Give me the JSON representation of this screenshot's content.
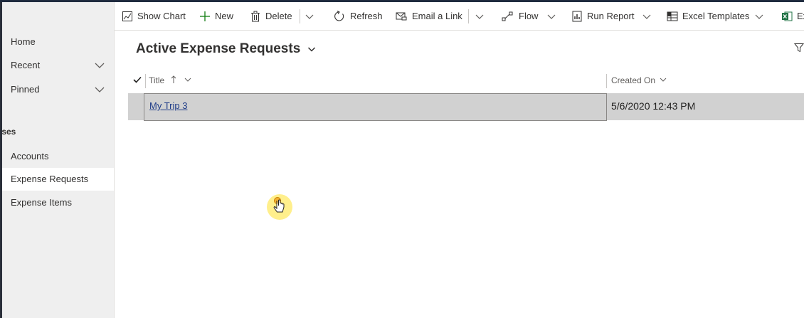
{
  "sidebar": {
    "items": [
      {
        "label": "Home"
      },
      {
        "label": "Recent",
        "has_chevron": true
      },
      {
        "label": "Pinned",
        "has_chevron": true
      }
    ],
    "section_header": "penses",
    "section_items": [
      {
        "label": "Accounts"
      },
      {
        "label": "Expense Requests",
        "selected": true
      },
      {
        "label": "Expense Items"
      }
    ]
  },
  "toolbar": {
    "show_chart": "Show Chart",
    "new": "New",
    "delete": "Delete",
    "refresh": "Refresh",
    "email_link": "Email a Link",
    "flow": "Flow",
    "run_report": "Run Report",
    "excel_templates": "Excel Templates",
    "export_truncated": "Ex"
  },
  "view": {
    "title": "Active Expense Requests"
  },
  "grid": {
    "columns": [
      {
        "label": "Title",
        "sort": "ascending"
      },
      {
        "label": "Created On"
      }
    ],
    "rows": [
      {
        "title": "My Trip 3",
        "created_on": "5/6/2020 12:43 PM",
        "selected": true
      }
    ]
  },
  "colors": {
    "sidebar_bg": "#efefef",
    "selected_row": "#d1d1d1",
    "link": "#1f3c88",
    "excel_green": "#217346",
    "cursor_halo": "#ffec78"
  }
}
